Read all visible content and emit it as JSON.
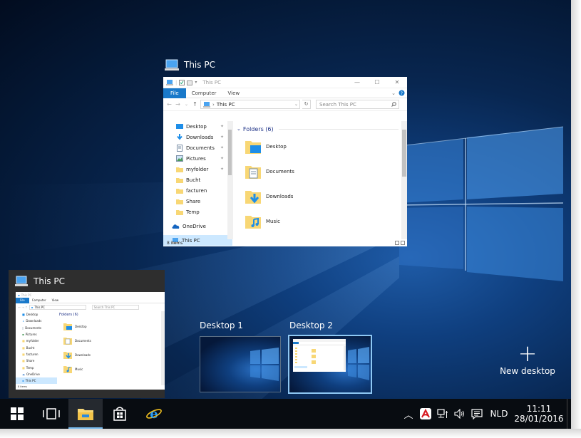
{
  "window": {
    "title": "This PC",
    "titlebar_text": "This PC",
    "ribbon_tabs": [
      "File",
      "Computer",
      "View"
    ],
    "address_text": "This PC",
    "search_placeholder": "Search This PC",
    "nav_items": [
      {
        "label": "Desktop",
        "icon": "desktop-folder-icon",
        "pinned": true
      },
      {
        "label": "Downloads",
        "icon": "downloads-folder-icon",
        "pinned": true
      },
      {
        "label": "Documents",
        "icon": "documents-folder-icon",
        "pinned": true
      },
      {
        "label": "Pictures",
        "icon": "pictures-folder-icon",
        "pinned": true
      },
      {
        "label": "myfolder",
        "icon": "folder-icon",
        "pinned": true
      },
      {
        "label": "Bucht",
        "icon": "folder-icon",
        "pinned": false
      },
      {
        "label": "facturen",
        "icon": "folder-icon",
        "pinned": false
      },
      {
        "label": "Share",
        "icon": "folder-icon",
        "pinned": false
      },
      {
        "label": "Temp",
        "icon": "folder-icon",
        "pinned": false
      },
      {
        "label": "OneDrive",
        "icon": "onedrive-icon",
        "pinned": false
      },
      {
        "label": "This PC",
        "icon": "this-pc-icon",
        "pinned": false,
        "selected": true
      }
    ],
    "group_header": "Folders (6)",
    "folders": [
      {
        "label": "Desktop",
        "icon": "desktop-folder-icon"
      },
      {
        "label": "Documents",
        "icon": "documents-folder-icon"
      },
      {
        "label": "Downloads",
        "icon": "downloads-folder-icon"
      },
      {
        "label": "Music",
        "icon": "music-folder-icon"
      }
    ],
    "status": "8 items"
  },
  "tile": {
    "title": "This PC",
    "titlebar_text": "This PC",
    "group_header": "Folders (6)",
    "mini_nav": [
      "Desktop",
      "Downloads",
      "Documents",
      "Pictures",
      "myfolder",
      "Bucht",
      "facturen",
      "Share",
      "Temp",
      "OneDrive",
      "This PC"
    ],
    "mini_folders": [
      "Desktop",
      "Documents",
      "Downloads",
      "Music"
    ],
    "status": "8 items"
  },
  "desktops": {
    "desktop1_label": "Desktop 1",
    "desktop2_label": "Desktop 2",
    "new_desktop_label": "New desktop"
  },
  "taskbar": {
    "language": "NLD",
    "time": "11:11",
    "date": "28/01/2016",
    "apps": [
      "start-icon",
      "task-view-icon",
      "file-explorer-icon",
      "store-icon",
      "internet-explorer-icon"
    ]
  },
  "colors": {
    "accent": "#1979ca",
    "selection": "#cce8ff",
    "taskbar": "#080c11",
    "tile_bg": "#2e2e2e",
    "active_desktop_border": "#8ec8f4"
  }
}
